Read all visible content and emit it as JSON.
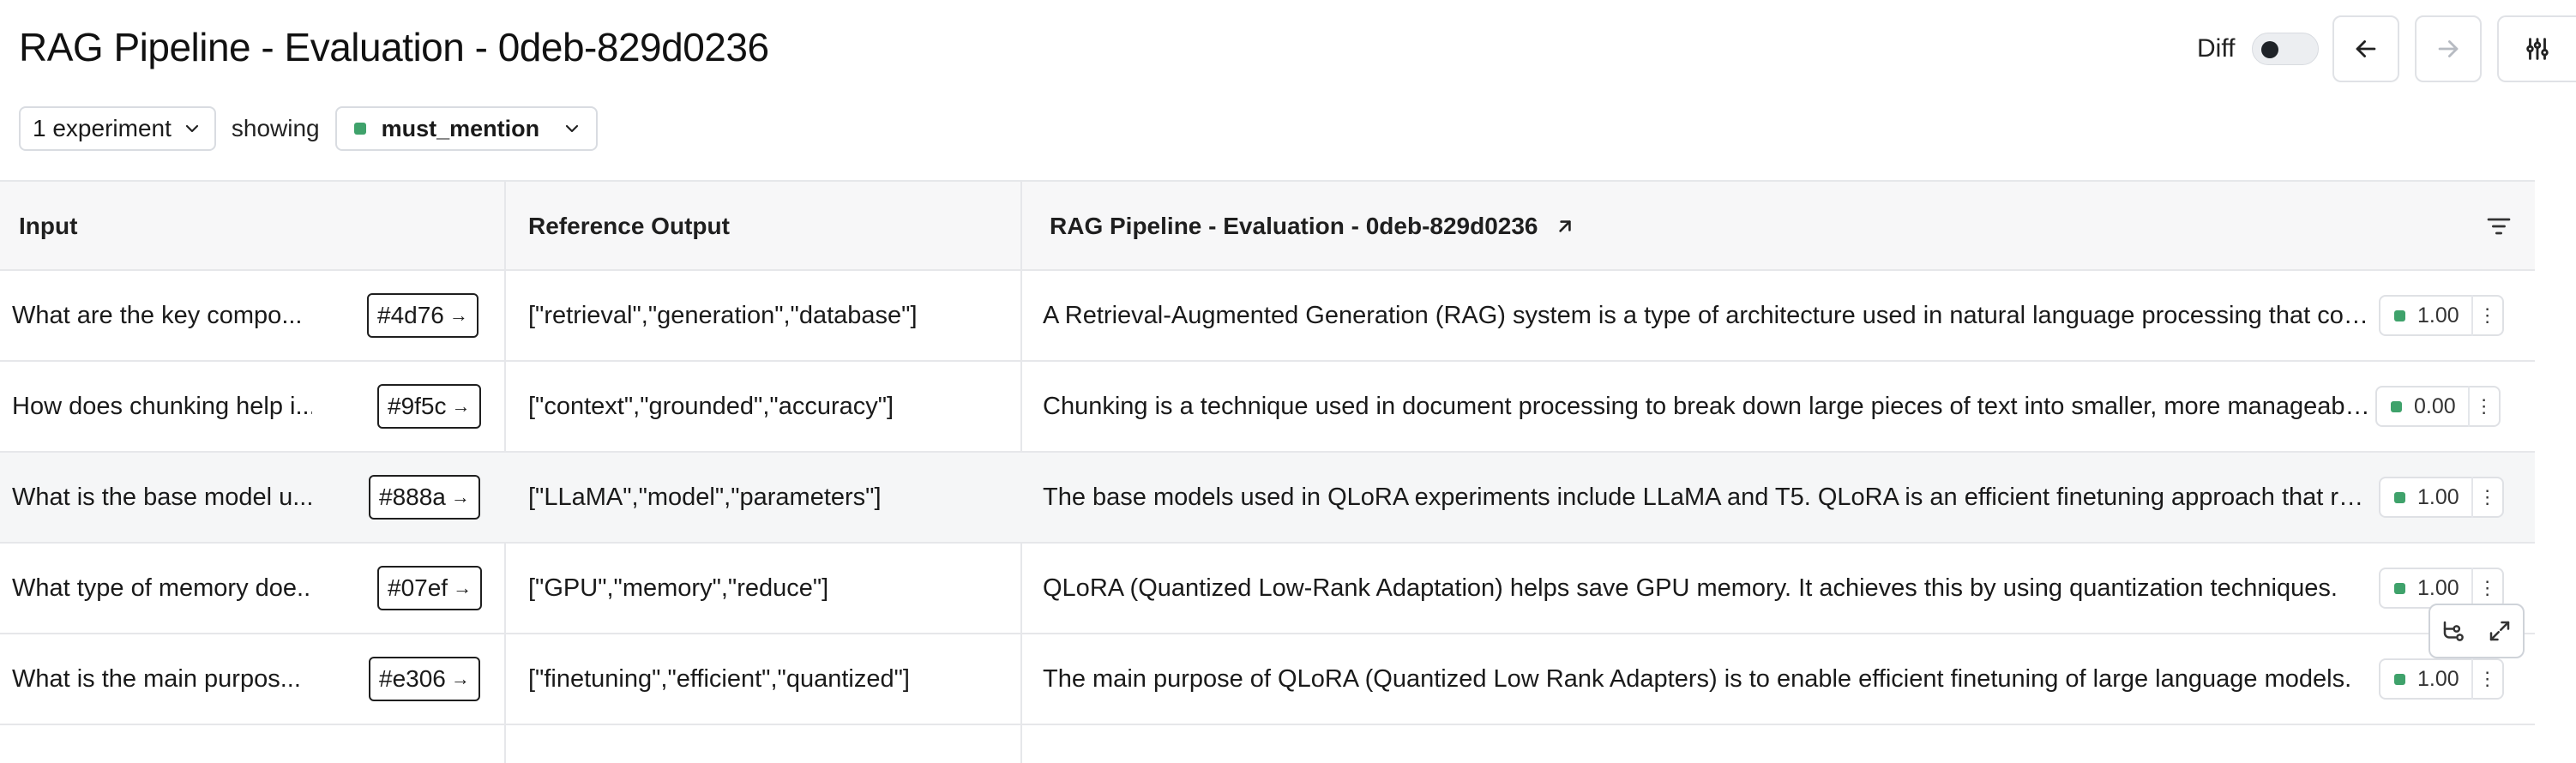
{
  "header": {
    "title": "RAG Pipeline - Evaluation - 0deb-829d0236",
    "diff_label": "Diff",
    "diff_enabled": false,
    "experiments_select": "1 experiment",
    "showing_label": "showing",
    "feedback_select": "must_mention",
    "feedback_color": "#3fa26b"
  },
  "table": {
    "columns": [
      "Input",
      "Reference Output",
      "RAG Pipeline - Evaluation - 0deb-829d0236"
    ],
    "rows": [
      {
        "input": "What are the key compo...",
        "id": "#4d76",
        "reference": "[\"retrieval\",\"generation\",\"database\"]",
        "output": "A Retrieval-Augmented Generation (RAG) system is a type of architecture used in natural language processing that combines retrieval and generation components.",
        "score": "1.00"
      },
      {
        "input": "How does chunking help i...",
        "id": "#9f5c",
        "reference": "[\"context\",\"grounded\",\"accuracy\"]",
        "output": "Chunking is a technique used in document processing to break down large pieces of text into smaller, more manageable chunks.",
        "score": "0.00"
      },
      {
        "input": "What is the base model u...",
        "id": "#888a",
        "reference": "[\"LLaMA\",\"model\",\"parameters\"]",
        "output": "The base models used in QLoRA experiments include LLaMA and T5. QLoRA is an efficient finetuning approach that reduces memory usage.",
        "score": "1.00"
      },
      {
        "input": "What type of memory doe...",
        "id": "#07ef",
        "reference": "[\"GPU\",\"memory\",\"reduce\"]",
        "output": "QLoRA (Quantized Low-Rank Adaptation) helps save GPU memory. It achieves this by using quantization techniques.",
        "score": "1.00"
      },
      {
        "input": "What is the main purpos...",
        "id": "#e306",
        "reference": "[\"finetuning\",\"efficient\",\"quantized\"]",
        "output": "The main purpose of QLoRA (Quantized Low Rank Adapters) is to enable efficient finetuning of large language models.",
        "score": "1.00"
      }
    ]
  },
  "icons": {
    "back": "arrow-left-icon",
    "forward": "arrow-right-icon",
    "settings": "sliders-icon",
    "open": "arrow-up-right-icon",
    "filter": "filter-lines-icon",
    "more": "more-vertical-icon",
    "trace": "trace-icon",
    "expand": "expand-icon"
  }
}
